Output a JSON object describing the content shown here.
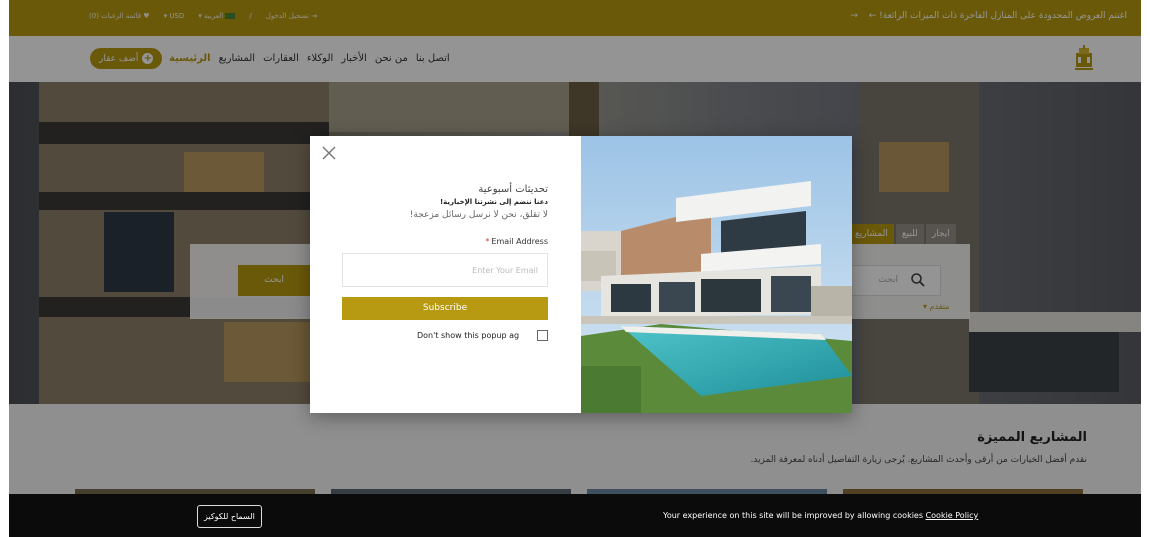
{
  "topbar": {
    "promo": "اغتنم العروض المحدودة على المنازل الفاخرة ذات الميزات الرائعة!",
    "promo_arrow": "→",
    "promo_arrow_left": "←",
    "wishlist": "قائمة الرغبات (0)",
    "currency": "USD ▾",
    "language": "العربية ▾",
    "separator": "/",
    "login": "تسجيل الدخول"
  },
  "nav": {
    "items": [
      "الرئيسية",
      "المشاريع",
      "العقارات",
      "الوكلاء",
      "الأخبار",
      "من نحن",
      "اتصل بنا"
    ],
    "add_property": "أضف عقار"
  },
  "hero": {
    "tabs": [
      "المشاريع",
      "للبيع",
      "ايجار"
    ],
    "search_placeholder": "ابحث",
    "search_button": "ابحث",
    "advanced": "متقدم ▾"
  },
  "modal": {
    "heading": "تحديثات أسبوعية",
    "subheading": "دعنا ننضم إلى نشرتنا الإخبارية!",
    "note": "لا تقلق، نحن لا نرسل رسائل مزعجة!",
    "email_label": "Email Address",
    "required_mark": "*",
    "email_placeholder": "Enter Your Email",
    "subscribe": "Subscribe",
    "dont_show": "Don't show this popup ag"
  },
  "featured": {
    "title": "المشاريع المميزة",
    "subtitle": "نقدم أفضل الخيارات من أرقى وأحدث المشاريع. يُرجى زيارة التفاصيل أدناه لمعرفة المزيد."
  },
  "cookie": {
    "message": "Your experience on this site will be improved by allowing cookies",
    "policy_link": "Cookie Policy",
    "allow_button": "السماح للكوكيز"
  },
  "colors": {
    "accent": "#b89a12",
    "cookie_bg": "#0b0b0b"
  }
}
